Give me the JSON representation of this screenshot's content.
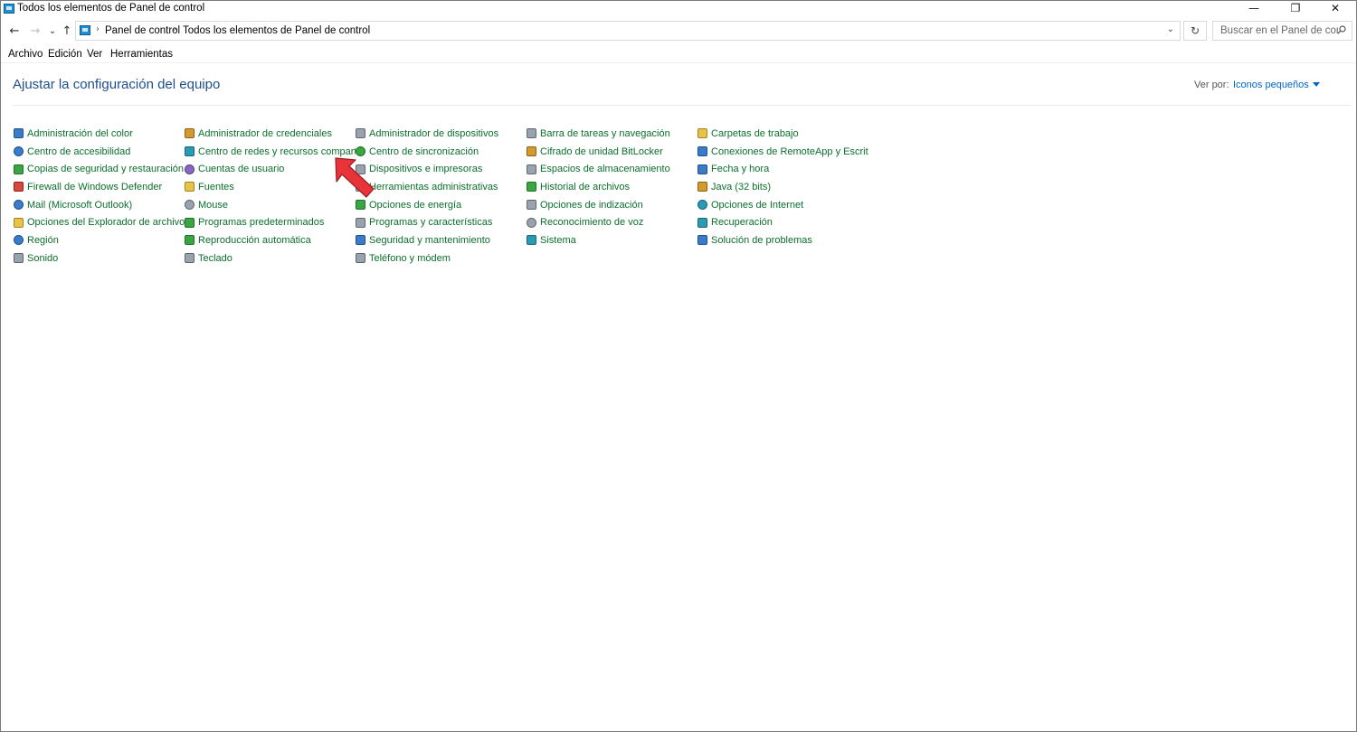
{
  "window": {
    "title": "Todos los elementos de Panel de control",
    "controls": {
      "minimize": "—",
      "restore": "❐",
      "close": "✕"
    }
  },
  "nav": {
    "back": "←",
    "forward": "→",
    "recent": "⌄",
    "up": "↑",
    "breadcrumb": [
      "Panel de control",
      "Todos los elementos de Panel de control"
    ],
    "separator": "›",
    "dropdown": "⌄",
    "refresh": "↻",
    "search_placeholder": "Buscar en el Panel de control"
  },
  "menu": [
    "Archivo",
    "Edición",
    "Ver",
    "Herramientas"
  ],
  "content": {
    "heading": "Ajustar la configuración del equipo",
    "view_by_label": "Ver por:",
    "view_by_value": "Iconos pequeños",
    "colors": {
      "link": "#0b6e2c",
      "heading": "#1e4e8c",
      "accent": "#0066cc",
      "pointer": "#e8333a"
    },
    "items": [
      {
        "label": "Administración del color",
        "icon": "color-management-icon",
        "color": "c-blue"
      },
      {
        "label": "Administrador de credenciales",
        "icon": "credential-manager-icon",
        "color": "c-orange"
      },
      {
        "label": "Administrador de dispositivos",
        "icon": "device-manager-icon",
        "color": "c-gray"
      },
      {
        "label": "Barra de tareas y navegación",
        "icon": "taskbar-icon",
        "color": "c-gray"
      },
      {
        "label": "Carpetas de trabajo",
        "icon": "work-folders-icon",
        "color": "c-yellow"
      },
      {
        "label": "Centro de accesibilidad",
        "icon": "accessibility-icon",
        "color": "c-blue round"
      },
      {
        "label": "Centro de redes y recursos comparti...",
        "icon": "network-center-icon",
        "color": "c-teal"
      },
      {
        "label": "Centro de sincronización",
        "icon": "sync-center-icon",
        "color": "c-green round"
      },
      {
        "label": "Cifrado de unidad BitLocker",
        "icon": "bitlocker-icon",
        "color": "c-orange"
      },
      {
        "label": "Conexiones de RemoteApp y Escrito...",
        "icon": "remoteapp-icon",
        "color": "c-blue"
      },
      {
        "label": "Copias de seguridad y restauración (...",
        "icon": "backup-icon",
        "color": "c-green"
      },
      {
        "label": "Cuentas de usuario",
        "icon": "user-accounts-icon",
        "color": "c-purple round"
      },
      {
        "label": "Dispositivos e impresoras",
        "icon": "devices-printers-icon",
        "color": "c-gray"
      },
      {
        "label": "Espacios de almacenamiento",
        "icon": "storage-spaces-icon",
        "color": "c-gray"
      },
      {
        "label": "Fecha y hora",
        "icon": "date-time-icon",
        "color": "c-blue"
      },
      {
        "label": "Firewall de Windows Defender",
        "icon": "firewall-icon",
        "color": "c-red"
      },
      {
        "label": "Fuentes",
        "icon": "fonts-icon",
        "color": "c-yellow"
      },
      {
        "label": "Herramientas administrativas",
        "icon": "admin-tools-icon",
        "color": "c-gray"
      },
      {
        "label": "Historial de archivos",
        "icon": "file-history-icon",
        "color": "c-green"
      },
      {
        "label": "Java (32 bits)",
        "icon": "java-icon",
        "color": "c-orange"
      },
      {
        "label": "Mail (Microsoft Outlook)",
        "icon": "mail-icon",
        "color": "c-blue round"
      },
      {
        "label": "Mouse",
        "icon": "mouse-icon",
        "color": "c-gray round"
      },
      {
        "label": "Opciones de energía",
        "icon": "power-options-icon",
        "color": "c-green"
      },
      {
        "label": "Opciones de indización",
        "icon": "indexing-icon",
        "color": "c-gray"
      },
      {
        "label": "Opciones de Internet",
        "icon": "internet-options-icon",
        "color": "c-teal round"
      },
      {
        "label": "Opciones del Explorador de archivos",
        "icon": "explorer-options-icon",
        "color": "c-yellow"
      },
      {
        "label": "Programas predeterminados",
        "icon": "default-programs-icon",
        "color": "c-green"
      },
      {
        "label": "Programas y características",
        "icon": "programs-features-icon",
        "color": "c-gray"
      },
      {
        "label": "Reconocimiento de voz",
        "icon": "speech-recognition-icon",
        "color": "c-gray round"
      },
      {
        "label": "Recuperación",
        "icon": "recovery-icon",
        "color": "c-teal"
      },
      {
        "label": "Región",
        "icon": "region-icon",
        "color": "c-blue round"
      },
      {
        "label": "Reproducción automática",
        "icon": "autoplay-icon",
        "color": "c-green"
      },
      {
        "label": "Seguridad y mantenimiento",
        "icon": "security-maintenance-icon",
        "color": "c-blue"
      },
      {
        "label": "Sistema",
        "icon": "system-icon",
        "color": "c-teal"
      },
      {
        "label": "Solución de problemas",
        "icon": "troubleshooting-icon",
        "color": "c-blue"
      },
      {
        "label": "Sonido",
        "icon": "sound-icon",
        "color": "c-gray"
      },
      {
        "label": "Teclado",
        "icon": "keyboard-icon",
        "color": "c-gray"
      },
      {
        "label": "Teléfono y módem",
        "icon": "phone-modem-icon",
        "color": "c-gray"
      }
    ]
  }
}
